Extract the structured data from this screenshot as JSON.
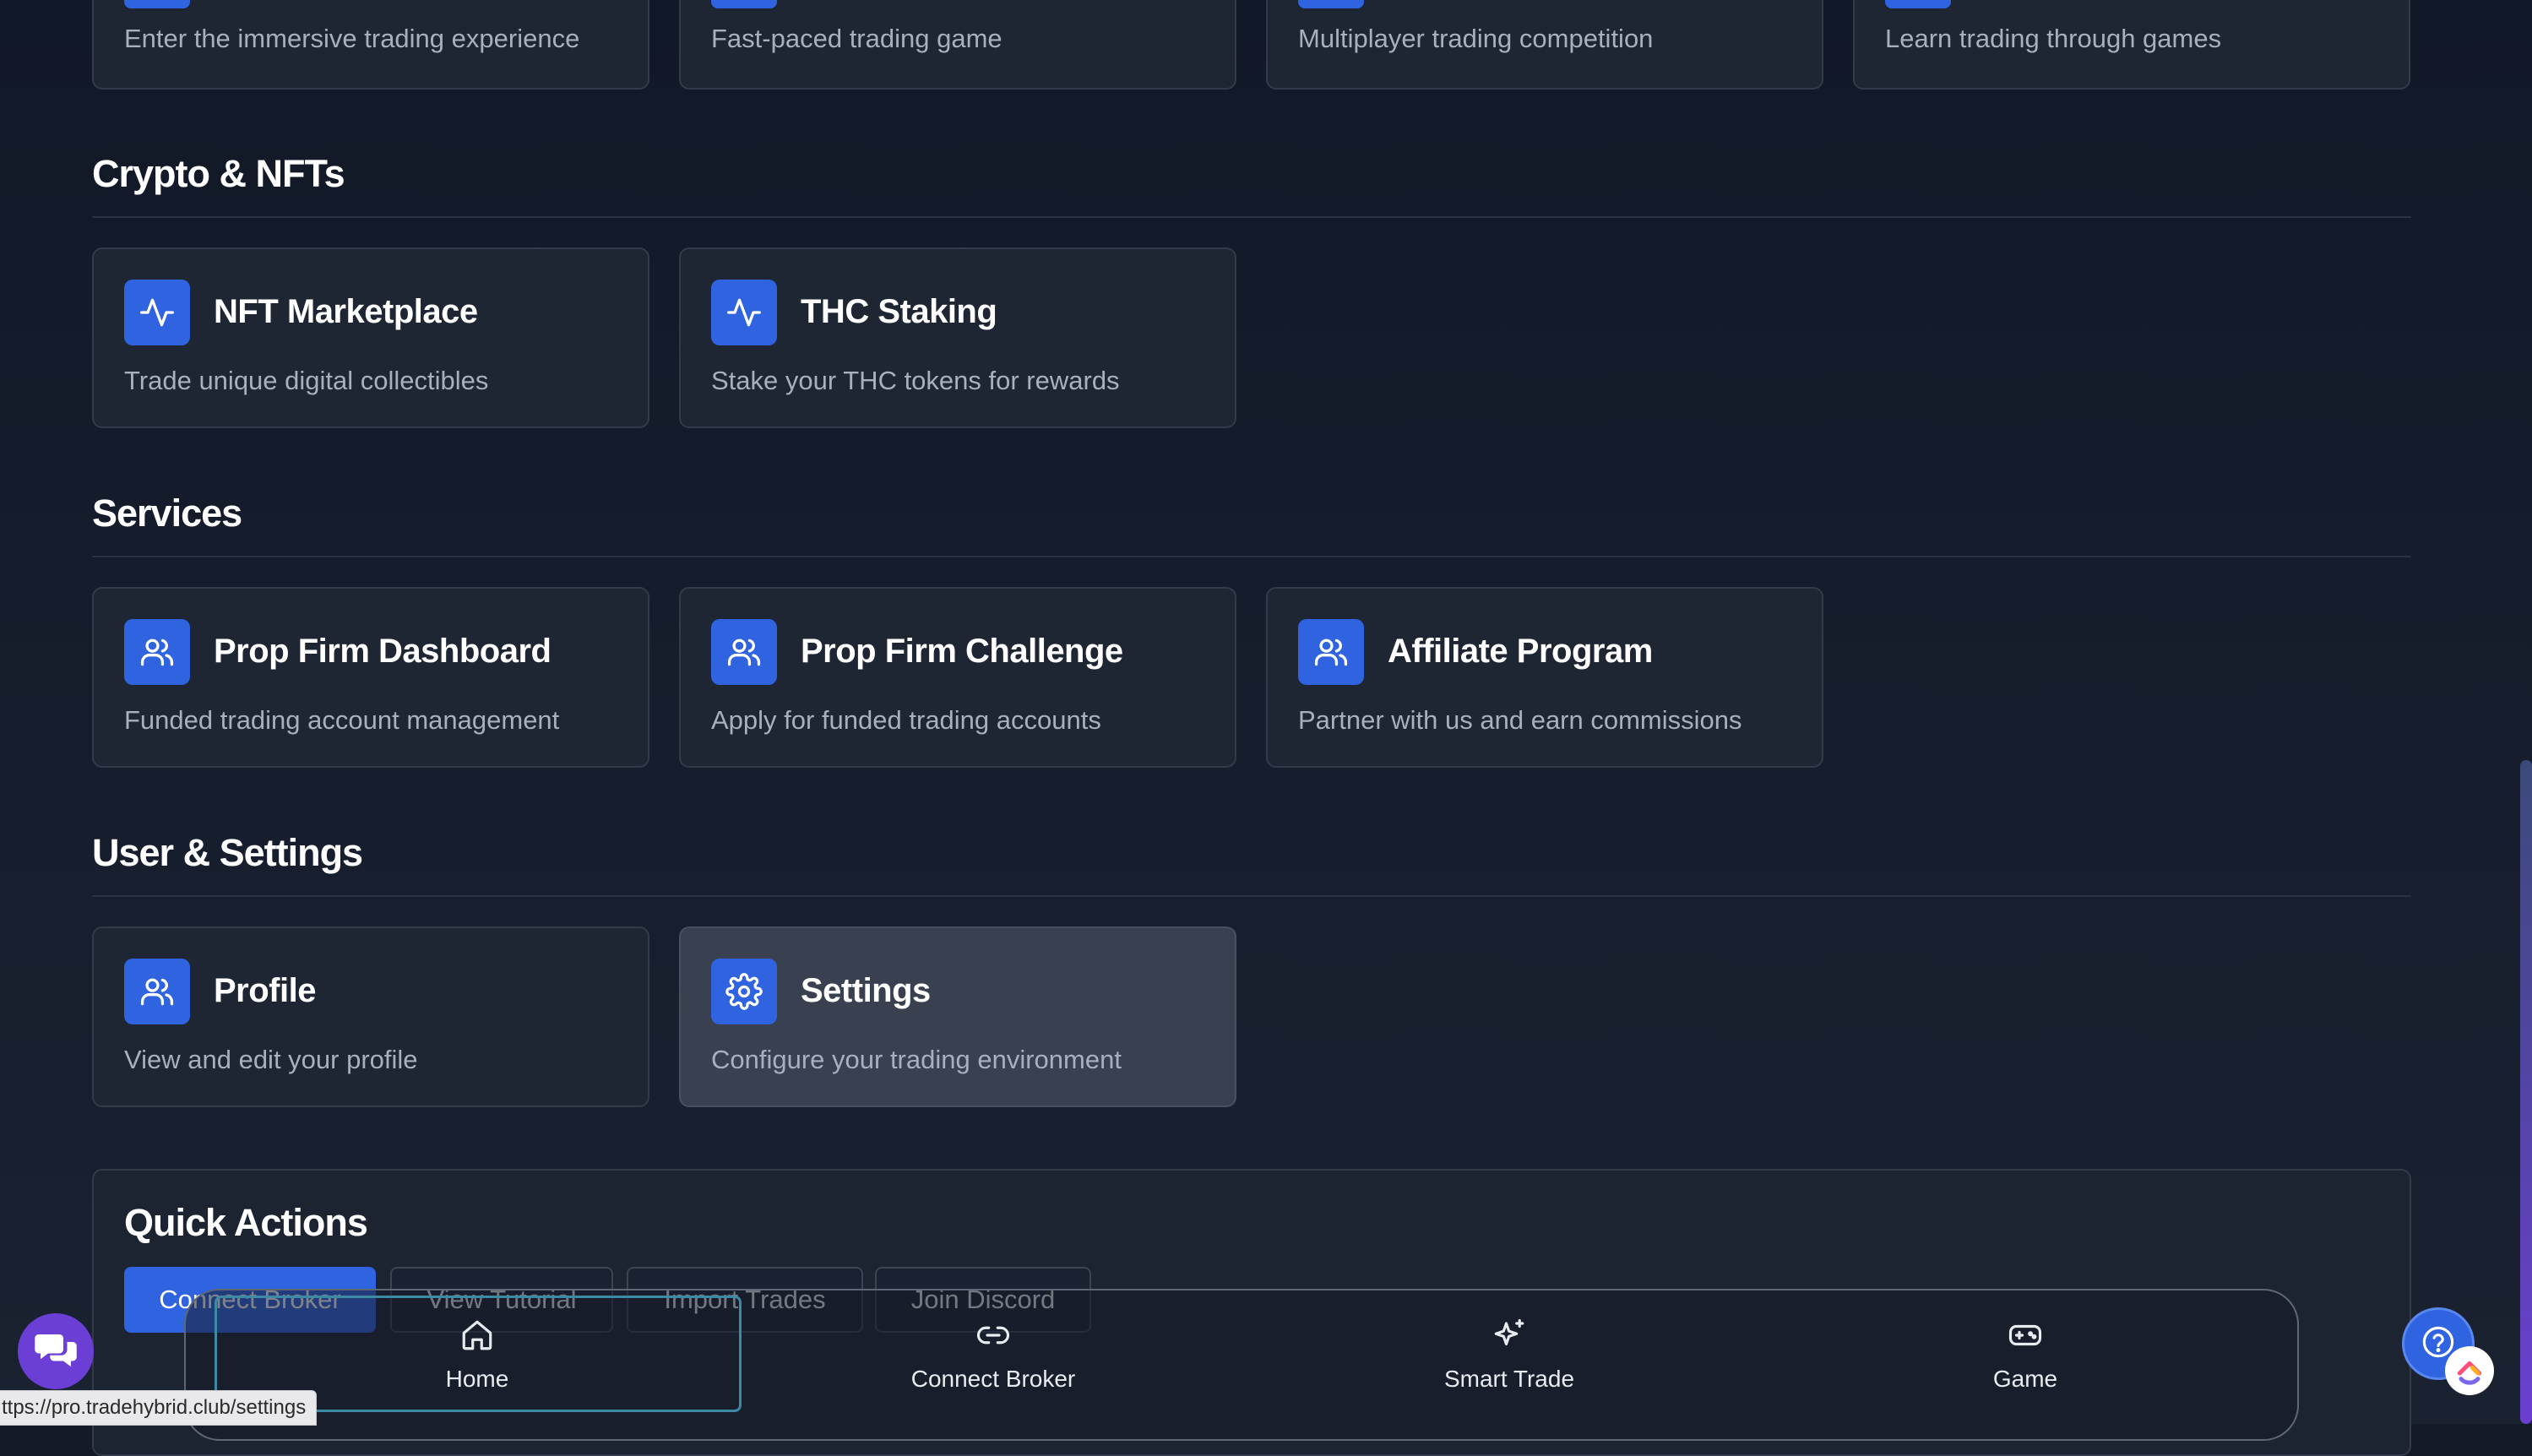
{
  "top_cards": [
    {
      "desc": "Enter the immersive trading experience"
    },
    {
      "desc": "Fast-paced trading game"
    },
    {
      "desc": "Multiplayer trading competition"
    },
    {
      "desc": "Learn trading through games"
    }
  ],
  "sections": {
    "crypto": {
      "title": "Crypto & NFTs",
      "cards": [
        {
          "title": "NFT Marketplace",
          "desc": "Trade unique digital collectibles",
          "icon": "activity-icon"
        },
        {
          "title": "THC Staking",
          "desc": "Stake your THC tokens for rewards",
          "icon": "activity-icon"
        }
      ]
    },
    "services": {
      "title": "Services",
      "cards": [
        {
          "title": "Prop Firm Dashboard",
          "desc": "Funded trading account management",
          "icon": "users-icon"
        },
        {
          "title": "Prop Firm Challenge",
          "desc": "Apply for funded trading accounts",
          "icon": "users-icon"
        },
        {
          "title": "Affiliate Program",
          "desc": "Partner with us and earn commissions",
          "icon": "users-icon"
        }
      ]
    },
    "user": {
      "title": "User & Settings",
      "cards": [
        {
          "title": "Profile",
          "desc": "View and edit your profile",
          "icon": "users-icon"
        },
        {
          "title": "Settings",
          "desc": "Configure your trading environment",
          "icon": "gear-icon"
        }
      ]
    }
  },
  "quick_actions": {
    "title": "Quick Actions",
    "buttons": [
      "Connect Broker",
      "View Tutorial",
      "Import Trades",
      "Join Discord"
    ]
  },
  "bottom_nav": {
    "items": [
      {
        "label": "Home",
        "icon": "home-icon"
      },
      {
        "label": "Connect Broker",
        "icon": "link-icon"
      },
      {
        "label": "Smart Trade",
        "icon": "sparkles-icon"
      },
      {
        "label": "Game",
        "icon": "gamepad-icon"
      }
    ]
  },
  "status_url": "ttps://pro.tradehybrid.club/settings",
  "colors": {
    "accent": "#2f63e0",
    "background": "#141a27",
    "card": "#1e2533",
    "chat": "#6b3fd6"
  }
}
